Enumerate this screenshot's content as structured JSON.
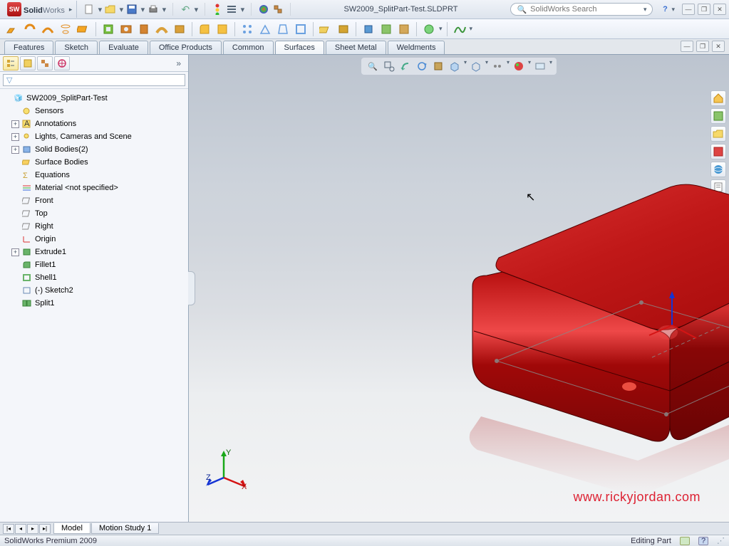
{
  "app": {
    "logo_sw": "SW",
    "logo_main": "Solid",
    "logo_sub": "Works"
  },
  "document_title": "SW2009_SplitPart-Test.SLDPRT",
  "search": {
    "placeholder": "SolidWorks Search"
  },
  "help_icon": "?",
  "ribbon_tabs": {
    "t0": "Features",
    "t1": "Sketch",
    "t2": "Evaluate",
    "t3": "Office Products",
    "t4": "Common",
    "t5": "Surfaces",
    "t6": "Sheet Metal",
    "t7": "Weldments"
  },
  "filter_icon": "▽",
  "tree": {
    "root": "SW2009_SplitPart-Test",
    "sensors": "Sensors",
    "annotations": "Annotations",
    "lights": "Lights, Cameras and Scene",
    "solid_bodies": "Solid Bodies(2)",
    "surface_bodies": "Surface Bodies",
    "equations": "Equations",
    "material": "Material <not specified>",
    "front": "Front",
    "top": "Top",
    "right": "Right",
    "origin": "Origin",
    "extrude1": "Extrude1",
    "fillet1": "Fillet1",
    "shell1": "Shell1",
    "sketch2": "(-) Sketch2",
    "split1": "Split1"
  },
  "bottom_tabs": {
    "model": "Model",
    "motion": "Motion Study 1"
  },
  "status": {
    "left": "SolidWorks Premium 2009",
    "right": "Editing Part"
  },
  "watermark": "www.rickyjordan.com",
  "triad": {
    "x": "X",
    "y": "Y",
    "z": "Z"
  },
  "view_icons": {
    "zoom_fit": "zoom-fit",
    "zoom_area": "zoom-area",
    "prev": "prev-view",
    "rotate": "rotate",
    "section": "section",
    "display": "display-style",
    "hide": "hide-show",
    "items": "items",
    "appearance": "appearance",
    "scene": "scene"
  },
  "side_icons": {
    "home": "home",
    "analysis": "analysis",
    "open": "open",
    "record": "record",
    "globe": "globe",
    "library": "library",
    "appear": "appearance"
  },
  "colors": {
    "model_top": "#c01818",
    "model_mid": "#aa0c0c",
    "model_dark": "#7a0606",
    "model_hilite": "#ee4848"
  }
}
